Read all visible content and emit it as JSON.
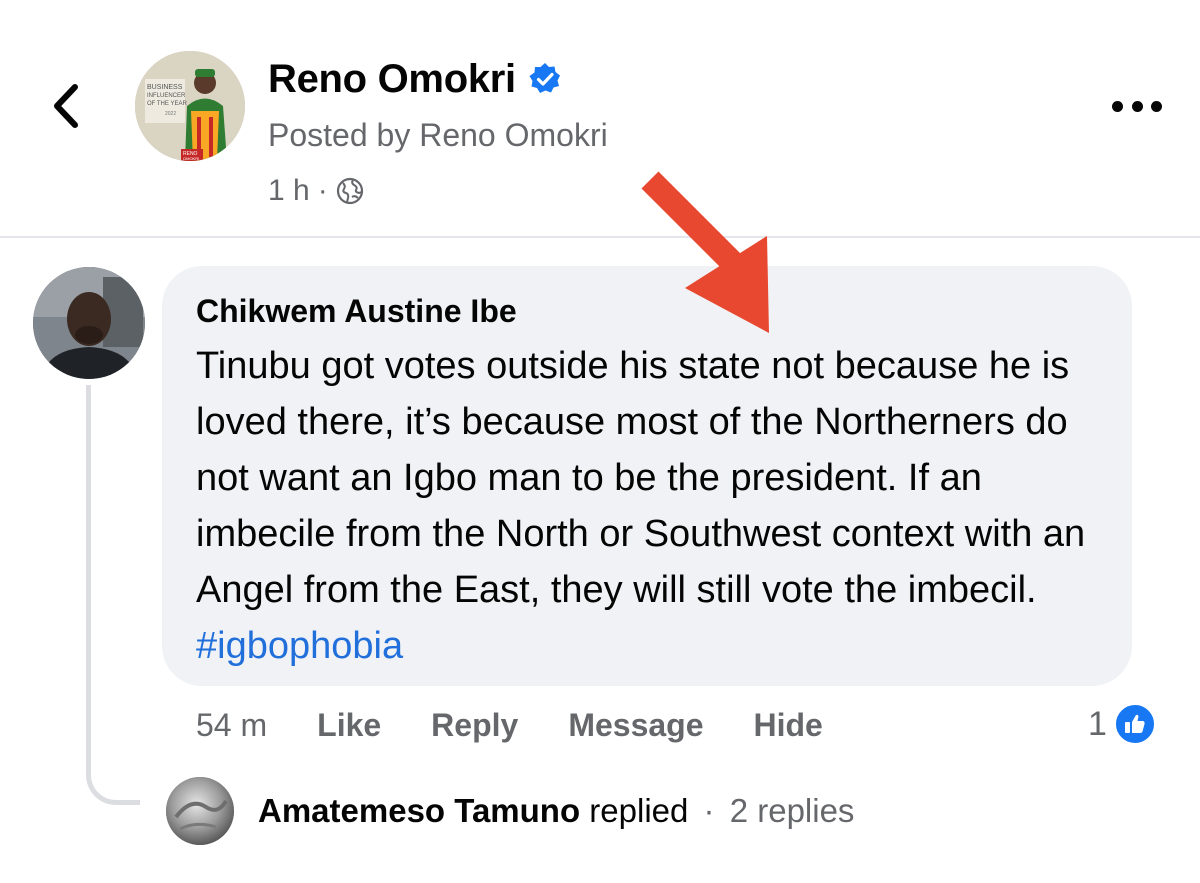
{
  "post": {
    "author_name": "Reno Omokri",
    "posted_by": "Posted by Reno Omokri",
    "time": "1 h",
    "separator": "·",
    "avatar_text": [
      "BUSINESS",
      "INFLUENCER",
      "OF THE YEAR",
      "2022",
      "RENO",
      "OMOKRI"
    ]
  },
  "comment": {
    "author": "Chikwem Austine Ibe",
    "text": "Tinubu got votes outside his state not because he is loved there, it’s because most of the Northerners do not want an Igbo man to be the president. If an imbecile from the North or Southwest context with an Angel from the East, they will still vote the imbecil. ",
    "hashtag": "#igbophobia",
    "time": "54 m",
    "actions": {
      "like": "Like",
      "reply": "Reply",
      "message": "Message",
      "hide": "Hide"
    },
    "reaction_count": "1"
  },
  "reply_summary": {
    "name": "Amatemeso Tamuno",
    "action": " replied",
    "separator": "·",
    "count": "2 replies"
  },
  "colors": {
    "accent_blue": "#1877f2",
    "hashtag_blue": "#216fdb",
    "annotation_arrow": "#e8482f",
    "bubble_bg": "#f0f2f5",
    "secondary_text": "#65676b"
  },
  "icons": [
    "back-chevron-icon",
    "verified-badge-icon",
    "globe-icon",
    "more-options-icon",
    "annotation-arrow-icon",
    "like-thumb-icon"
  ]
}
